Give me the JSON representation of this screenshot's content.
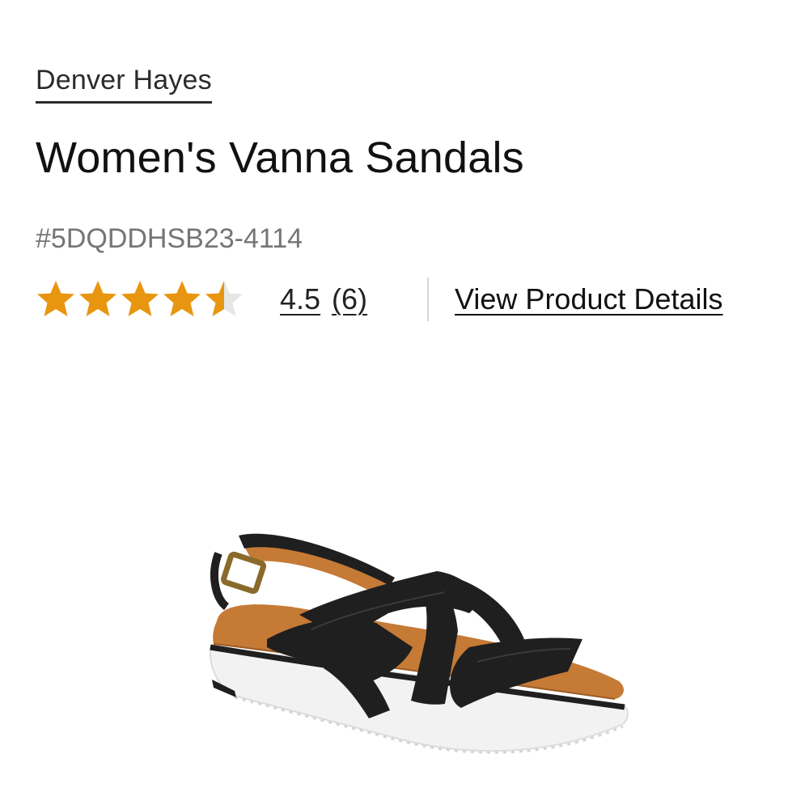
{
  "product": {
    "brand": "Denver Hayes",
    "title": "Women's Vanna Sandals",
    "sku": "#5DQDDHSB23-4114"
  },
  "rating": {
    "value": "4.5",
    "count": "(6)",
    "stars_filled": 4.5,
    "stars_total": 5,
    "star_color": "#E8960F",
    "star_empty_color": "#E6E6E6"
  },
  "links": {
    "view_details": "View Product Details"
  },
  "image": {
    "icon": "sandal-product-image",
    "strap_color": "#1F1F1F",
    "footbed_color": "#C57A36",
    "sole_color": "#F2F2F2"
  }
}
